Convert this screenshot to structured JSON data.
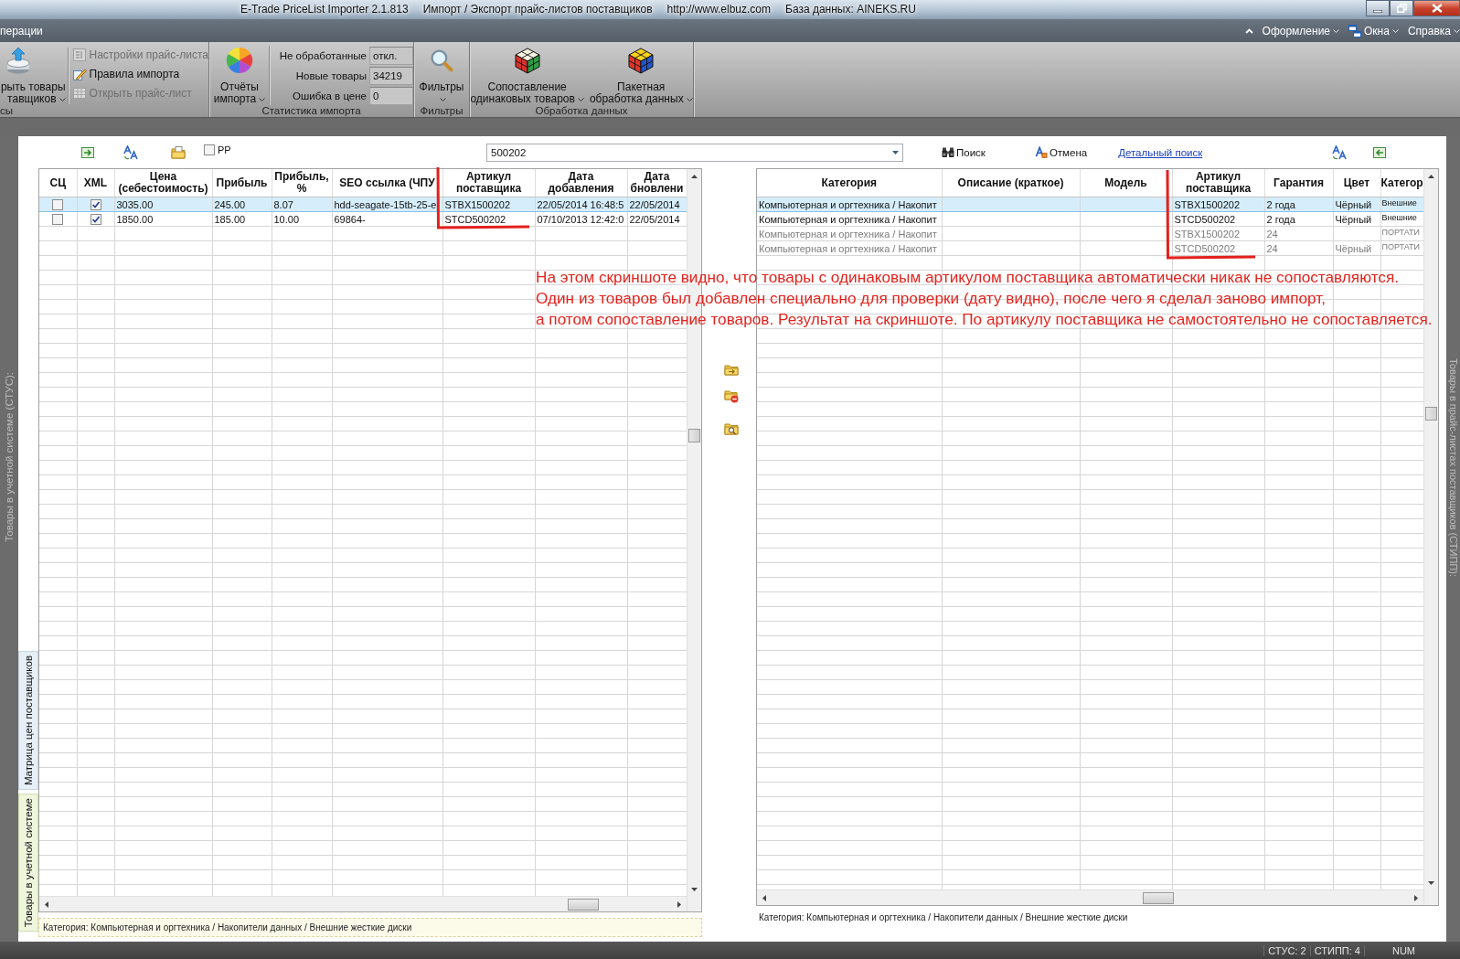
{
  "window": {
    "title_parts": [
      "E-Trade PriceList Importer 2.1.813",
      "Импорт / Экспорт прайс-листов поставщиков",
      "http://www.elbuz.com",
      "База данных: AINEKS.RU"
    ]
  },
  "ribbon": {
    "menu_tab": "перации",
    "right_menu": [
      {
        "label": "Оформление",
        "has_icon": false
      },
      {
        "label": "Окна",
        "has_icon": true
      },
      {
        "label": "Справка",
        "has_icon": false
      }
    ],
    "groups": [
      {
        "label": "сы",
        "large_buttons": [
          {
            "lines": [
              "рыть товары",
              "тавщиков"
            ],
            "dropdown": true
          }
        ],
        "small_buttons": [
          {
            "label": "Настройки прайс-листа",
            "disabled": true
          },
          {
            "label": "Правила импорта",
            "disabled": false
          },
          {
            "label": "Открыть прайс-лист",
            "disabled": true
          }
        ]
      },
      {
        "label": "Статистика импорта",
        "large_buttons": [
          {
            "lines": [
              "Отчёты",
              "импорта"
            ],
            "dropdown": true
          }
        ],
        "stats": [
          {
            "label": "Не обработанные",
            "value": "откл."
          },
          {
            "label": "Новые товары",
            "value": "34219"
          },
          {
            "label": "Ошибка в цене",
            "value": "0"
          }
        ]
      },
      {
        "label": "Фильтры",
        "large_buttons": [
          {
            "lines": [
              "Фильтры"
            ],
            "dropdown": true
          }
        ]
      },
      {
        "label": "Обработка данных",
        "large_buttons": [
          {
            "lines": [
              "Сопоставление",
              "одинаковых товаров"
            ],
            "dropdown": true
          },
          {
            "lines": [
              "Пакетная",
              "обработка данных"
            ],
            "dropdown": true
          }
        ]
      }
    ]
  },
  "toolbar": {
    "checkbox": {
      "label": "РР",
      "checked": false
    },
    "search": {
      "value": "500202"
    },
    "buttons": [
      {
        "label": "Поиск"
      },
      {
        "label": "Отмена"
      }
    ],
    "link": "Детальный поиск"
  },
  "left_panel": {
    "side_title": "Товары в учетной системе (СТУС):",
    "tabs": [
      {
        "label": "Матрица цен поставщиков",
        "selected": false
      },
      {
        "label": "Товары в учетной системе",
        "selected": true
      }
    ],
    "table": {
      "columns": [
        {
          "kind": "checkbox",
          "lines": [
            "СЦ"
          ]
        },
        {
          "kind": "checkbox",
          "lines": [
            "XML"
          ]
        },
        {
          "kind": "text",
          "lines": [
            "Цена",
            "(себестоимость)"
          ]
        },
        {
          "kind": "text",
          "lines": [
            "Прибыль"
          ]
        },
        {
          "kind": "text",
          "lines": [
            "Прибыль,",
            "%"
          ]
        },
        {
          "kind": "text",
          "lines": [
            "SEO ссылка (ЧПУ"
          ]
        },
        {
          "kind": "text",
          "lines": [
            "Артикул",
            "поставщика"
          ]
        },
        {
          "kind": "text",
          "lines": [
            "Дата",
            "добавления"
          ]
        },
        {
          "kind": "text",
          "lines": [
            "Дата",
            "бновлени"
          ]
        }
      ],
      "rows": [
        {
          "selected": true,
          "cells": [
            false,
            true,
            "3035.00",
            "245.00",
            "8.07",
            "hdd-seagate-15tb-25-e",
            "STBX1500202",
            "22/05/2014 16:48:5",
            "22/05/2014"
          ]
        },
        {
          "selected": false,
          "cells": [
            false,
            true,
            "1850.00",
            "185.00",
            "10.00",
            "69864-",
            "STCD500202",
            "07/10/2013 12:42:0",
            "22/05/2014"
          ]
        }
      ]
    },
    "category": "Категория: Компьютерная и оргтехника / Накопители данных / Внешние жесткие диски"
  },
  "right_panel": {
    "side_title": "Товары в прайс-листах поставщиков (СТИПП):",
    "table": {
      "columns": [
        {
          "lines": [
            "Категория"
          ]
        },
        {
          "lines": [
            "Описание (краткое)"
          ]
        },
        {
          "lines": [
            "Модель"
          ]
        },
        {
          "lines": [
            "Артикул",
            "поставщика"
          ]
        },
        {
          "lines": [
            "Гарантия"
          ]
        },
        {
          "lines": [
            "Цвет"
          ]
        },
        {
          "lines": [
            "Категор"
          ]
        }
      ],
      "rows": [
        {
          "selected": true,
          "dimmed": false,
          "description_focused": true,
          "category": "Компьютерная и оргтехника / Накопит",
          "supplier_sku": "STBX1500202",
          "warranty": "2 года",
          "colour_name": "Чёрный",
          "column_7": "Внешние"
        },
        {
          "selected": false,
          "dimmed": false,
          "description_focused": false,
          "category": "Компьютерная и оргтехника / Накопит",
          "supplier_sku": "STCD500202",
          "warranty": "2 года",
          "colour_name": "Чёрный",
          "column_7": "Внешние"
        },
        {
          "selected": false,
          "dimmed": true,
          "description_focused": false,
          "category": "Компьютерная и оргтехника / Накопит",
          "supplier_sku": "STBX1500202",
          "warranty": "24",
          "column_7": "ПОРТАТИ"
        },
        {
          "selected": false,
          "dimmed": true,
          "description_focused": false,
          "category": "Компьютерная и оргтехника / Накопит",
          "supplier_sku": "STCD500202",
          "warranty": "24",
          "colour_name": "Чёрный",
          "column_7": "ПОРТАТИ"
        }
      ]
    },
    "category": "Категория: Компьютерная и оргтехника / Накопители данных / Внешние жесткие диски"
  },
  "annotation": {
    "lines": [
      "На этом скриншоте видно, что товары с одинаковым артикулом поставщика автоматически никак не сопоставляются.",
      "Один из товаров был добавлен специально для проверки (дату видно), после чего я сделал заново импорт,",
      "а потом сопоставление товаров. Результат на скриншоте. По артикулу поставщика не самостоятельно не сопоставляется."
    ]
  },
  "status_bar": {
    "items": [
      "СТУС: 2",
      "СТИПП: 4",
      "NUM"
    ]
  }
}
